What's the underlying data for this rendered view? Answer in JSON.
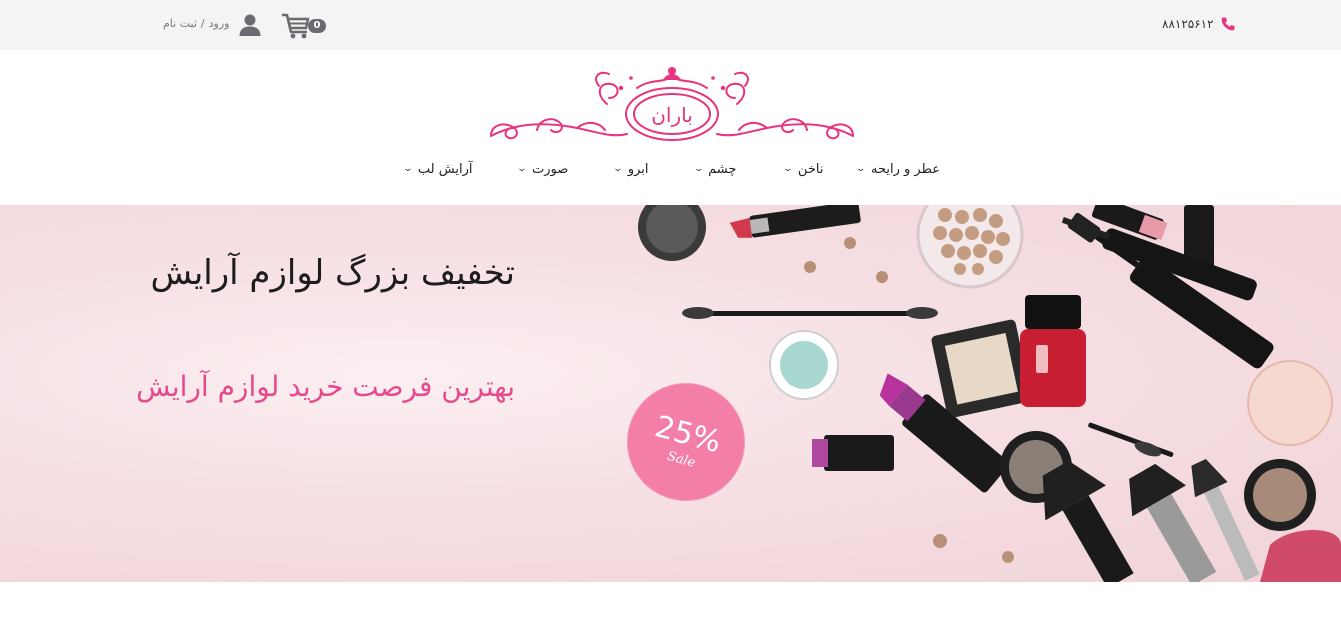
{
  "topbar": {
    "phone": "۸۸۱۲۵۶۱۲",
    "phone_icon": "phone-icon",
    "cart_count": "0",
    "cart_icon": "cart-icon",
    "user_icon": "user-icon",
    "login_label": "ورود",
    "separator": "/",
    "register_label": "ثبت نام"
  },
  "header": {
    "logo_text": "باران",
    "brand_color": "#e8347e"
  },
  "nav": {
    "items": [
      {
        "label": "عطر و رایحه"
      },
      {
        "label": "ناخن"
      },
      {
        "label": "چشم"
      },
      {
        "label": "ابرو"
      },
      {
        "label": "صورت"
      },
      {
        "label": "آرایش لب"
      }
    ],
    "chevron_icon": "chevron-down-icon"
  },
  "hero": {
    "title": "تخفیف بزرگ لوازم آرایش",
    "subtitle": "بهترین فرصت خرید لوازم آرایش",
    "badge_percent": "25%",
    "badge_word": "Sale",
    "accent_color": "#f37ea8"
  }
}
